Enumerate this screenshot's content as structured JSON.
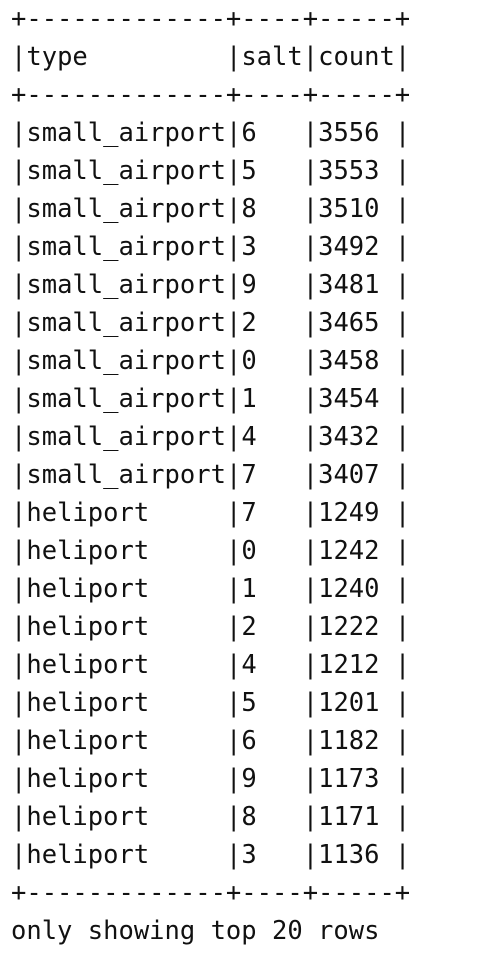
{
  "table": {
    "columns": [
      "type",
      "salt",
      "count"
    ],
    "rows": [
      [
        "small_airport",
        "6",
        "3556"
      ],
      [
        "small_airport",
        "5",
        "3553"
      ],
      [
        "small_airport",
        "8",
        "3510"
      ],
      [
        "small_airport",
        "3",
        "3492"
      ],
      [
        "small_airport",
        "9",
        "3481"
      ],
      [
        "small_airport",
        "2",
        "3465"
      ],
      [
        "small_airport",
        "0",
        "3458"
      ],
      [
        "small_airport",
        "1",
        "3454"
      ],
      [
        "small_airport",
        "4",
        "3432"
      ],
      [
        "small_airport",
        "7",
        "3407"
      ],
      [
        "heliport",
        "7",
        "1249"
      ],
      [
        "heliport",
        "0",
        "1242"
      ],
      [
        "heliport",
        "1",
        "1240"
      ],
      [
        "heliport",
        "2",
        "1222"
      ],
      [
        "heliport",
        "4",
        "1212"
      ],
      [
        "heliport",
        "5",
        "1201"
      ],
      [
        "heliport",
        "6",
        "1182"
      ],
      [
        "heliport",
        "9",
        "1173"
      ],
      [
        "heliport",
        "8",
        "1171"
      ],
      [
        "heliport",
        "3",
        "1136"
      ]
    ]
  },
  "footer": {
    "note": "only showing top 20 rows"
  }
}
